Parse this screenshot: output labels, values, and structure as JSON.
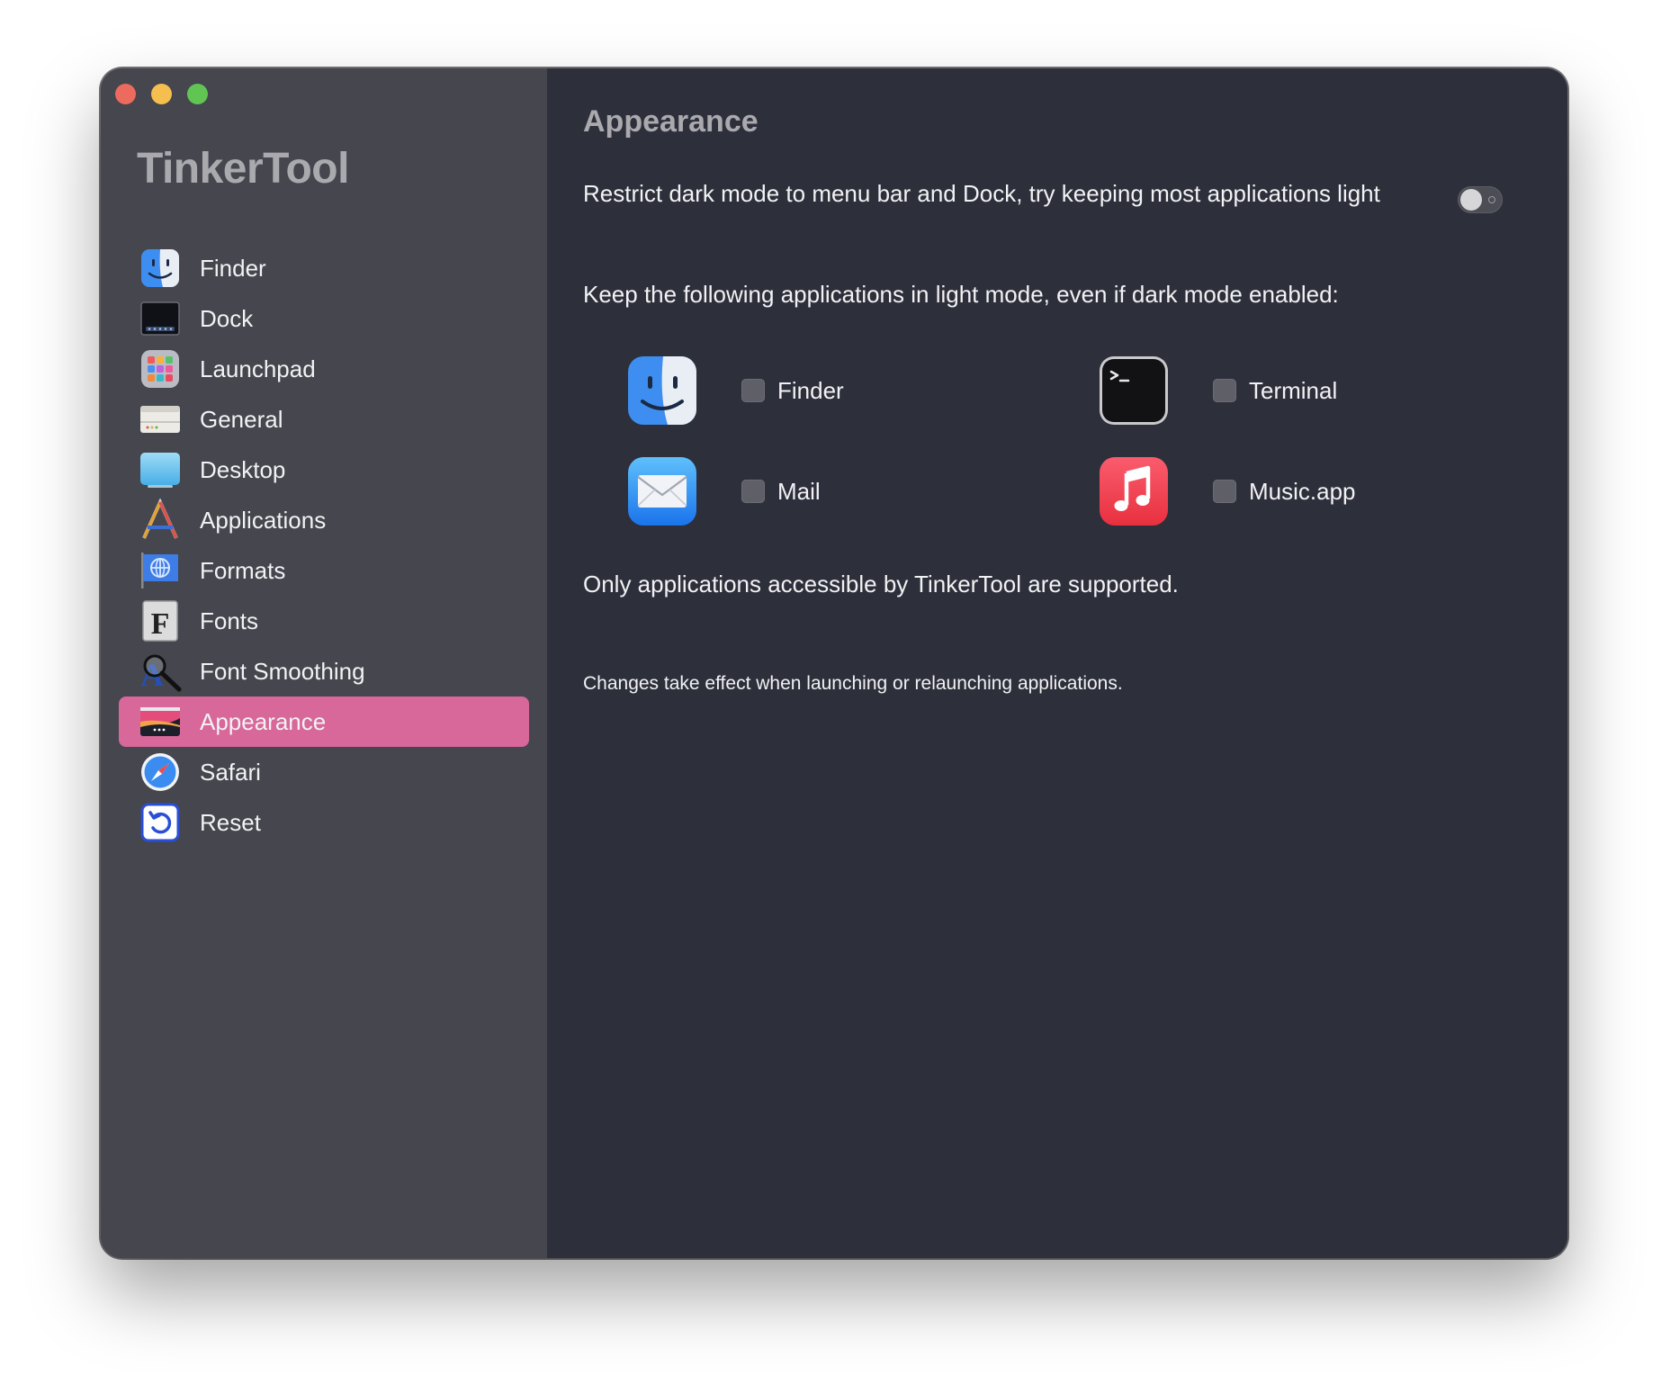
{
  "app": {
    "title": "TinkerTool"
  },
  "sidebar": {
    "items": [
      {
        "label": "Finder",
        "icon": "finder-icon"
      },
      {
        "label": "Dock",
        "icon": "dock-icon"
      },
      {
        "label": "Launchpad",
        "icon": "launchpad-icon"
      },
      {
        "label": "General",
        "icon": "general-icon"
      },
      {
        "label": "Desktop",
        "icon": "desktop-icon"
      },
      {
        "label": "Applications",
        "icon": "applications-icon"
      },
      {
        "label": "Formats",
        "icon": "formats-icon"
      },
      {
        "label": "Fonts",
        "icon": "fonts-icon"
      },
      {
        "label": "Font Smoothing",
        "icon": "font-smoothing-icon"
      },
      {
        "label": "Appearance",
        "icon": "appearance-icon",
        "selected": true
      },
      {
        "label": "Safari",
        "icon": "safari-icon"
      },
      {
        "label": "Reset",
        "icon": "reset-icon"
      }
    ]
  },
  "main": {
    "title": "Appearance",
    "restrict_label": "Restrict dark mode to menu bar and Dock, try keeping most applications light",
    "restrict_enabled": false,
    "keep_label": "Keep the following applications in light mode, even if dark mode enabled:",
    "apps": [
      {
        "name": "Finder",
        "icon": "finder-icon",
        "checked": false
      },
      {
        "name": "Terminal",
        "icon": "terminal-icon",
        "checked": false
      },
      {
        "name": "Mail",
        "icon": "mail-icon",
        "checked": false
      },
      {
        "name": "Music.app",
        "icon": "music-icon",
        "checked": false
      }
    ],
    "support_note": "Only applications accessible by TinkerTool are supported.",
    "changes_note": "Changes take effect when launching or relaunching applications."
  },
  "colors": {
    "sidebar_bg": "#45464e",
    "main_bg": "#2d2f3b",
    "selection": "#d8679a",
    "title_text": "#a9a9ae"
  }
}
